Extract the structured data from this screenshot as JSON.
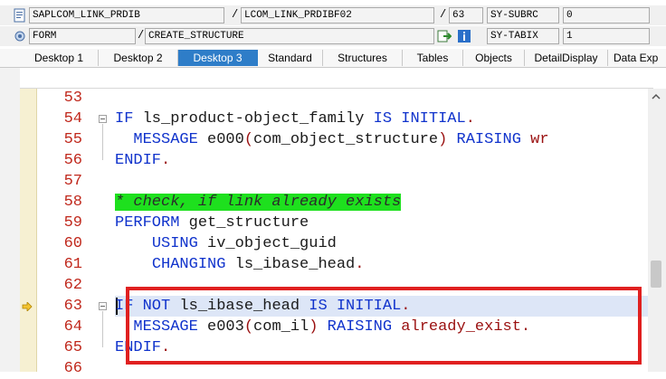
{
  "header": {
    "row1": {
      "program": "SAPLCOM_LINK_PRDIB",
      "slash1": "/",
      "include": "LCOM_LINK_PRDIBF02",
      "slash2": "/",
      "line": "63",
      "sysfield": "SY-SUBRC",
      "sysvalue": "0"
    },
    "row2": {
      "type": "FORM",
      "slash": "/",
      "name": "CREATE_STRUCTURE",
      "sysfield": "SY-TABIX",
      "sysvalue": "1"
    }
  },
  "tabs": [
    {
      "label": "Desktop 1"
    },
    {
      "label": "Desktop 2"
    },
    {
      "label": "Desktop 3",
      "active": true
    },
    {
      "label": "Standard"
    },
    {
      "label": "Structures"
    },
    {
      "label": "Tables"
    },
    {
      "label": "Objects"
    },
    {
      "label": "DetailDisplay"
    },
    {
      "label": "Data Exp"
    }
  ],
  "editor": {
    "lines": [
      {
        "num": "53",
        "code": ""
      },
      {
        "num": "54",
        "code": "IF ls_product-object_family IS INITIAL."
      },
      {
        "num": "55",
        "code": "  MESSAGE e000(com_object_structure) RAISING wr"
      },
      {
        "num": "56",
        "code": "ENDIF."
      },
      {
        "num": "57",
        "code": ""
      },
      {
        "num": "58",
        "code": "* check, if link already exists"
      },
      {
        "num": "59",
        "code": "PERFORM get_structure"
      },
      {
        "num": "60",
        "code": "    USING iv_object_guid"
      },
      {
        "num": "61",
        "code": "    CHANGING ls_ibase_head."
      },
      {
        "num": "62",
        "code": ""
      },
      {
        "num": "63",
        "code": "IF NOT ls_ibase_head IS INITIAL."
      },
      {
        "num": "64",
        "code": "  MESSAGE e003(com_il) RAISING already_exist."
      },
      {
        "num": "65",
        "code": "ENDIF."
      },
      {
        "num": "66",
        "code": ""
      }
    ],
    "current_line": "63"
  },
  "icons": {
    "row1": "program-icon",
    "row2": "form-icon",
    "breakpoint_marker": "current-line-arrow-icon",
    "nav": "navigate-icon",
    "info": "info-icon"
  },
  "colors": {
    "keyword": "#1033cc",
    "comment_bg": "#1ee01e",
    "line_number": "#c0281c",
    "tab_active": "#2e7dc8",
    "highlight_box": "#e02020"
  }
}
